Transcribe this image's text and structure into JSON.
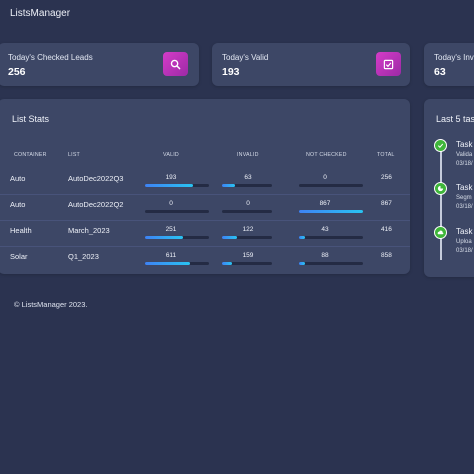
{
  "app": {
    "title": "ListsManager"
  },
  "stats": [
    {
      "label": "Today's Checked Leads",
      "value": "256",
      "icon": "search-icon",
      "color": "#c933c0"
    },
    {
      "label": "Today's Valid",
      "value": "193",
      "icon": "check-square-icon",
      "color": "#c933c0"
    },
    {
      "label": "Today's Inva",
      "value": "63"
    }
  ],
  "list_stats": {
    "title": "List Stats",
    "headers": {
      "container": "CONTAINER",
      "list": "LIST",
      "valid": "VALID",
      "invalid": "INVALID",
      "not_checked": "NOT CHECKED",
      "total": "TOTAL"
    },
    "rows": [
      {
        "container": "Auto",
        "list": "AutoDec2022Q3",
        "valid": "193",
        "invalid": "63",
        "not_checked": "0",
        "total": "256"
      },
      {
        "container": "Auto",
        "list": "AutoDec2022Q2",
        "valid": "0",
        "invalid": "0",
        "not_checked": "867",
        "total": "867"
      },
      {
        "container": "Health",
        "list": "March_2023",
        "valid": "251",
        "invalid": "122",
        "not_checked": "43",
        "total": "416"
      },
      {
        "container": "Solar",
        "list": "Q1_2023",
        "valid": "611",
        "invalid": "159",
        "not_checked": "88",
        "total": "858"
      }
    ],
    "bar_fill_percent": [
      {
        "valid": 75,
        "invalid": 25,
        "not_checked": 0
      },
      {
        "valid": 0,
        "invalid": 0,
        "not_checked": 100
      },
      {
        "valid": 60,
        "invalid": 29,
        "not_checked": 10
      },
      {
        "valid": 71,
        "invalid": 19,
        "not_checked": 10
      }
    ],
    "bar_colors": {
      "start": "#3e82f4",
      "end": "#29c4f2"
    }
  },
  "tasks": {
    "title": "Last 5 tas",
    "items": [
      {
        "title": "Task",
        "sub": "Valida",
        "date": "03/18/"
      },
      {
        "title": "Task",
        "sub": "Segm",
        "date": "03/18/"
      },
      {
        "title": "Task",
        "sub": "Uploa",
        "date": "03/18/"
      }
    ]
  },
  "footer": {
    "text": "© ListsManager 2023."
  }
}
